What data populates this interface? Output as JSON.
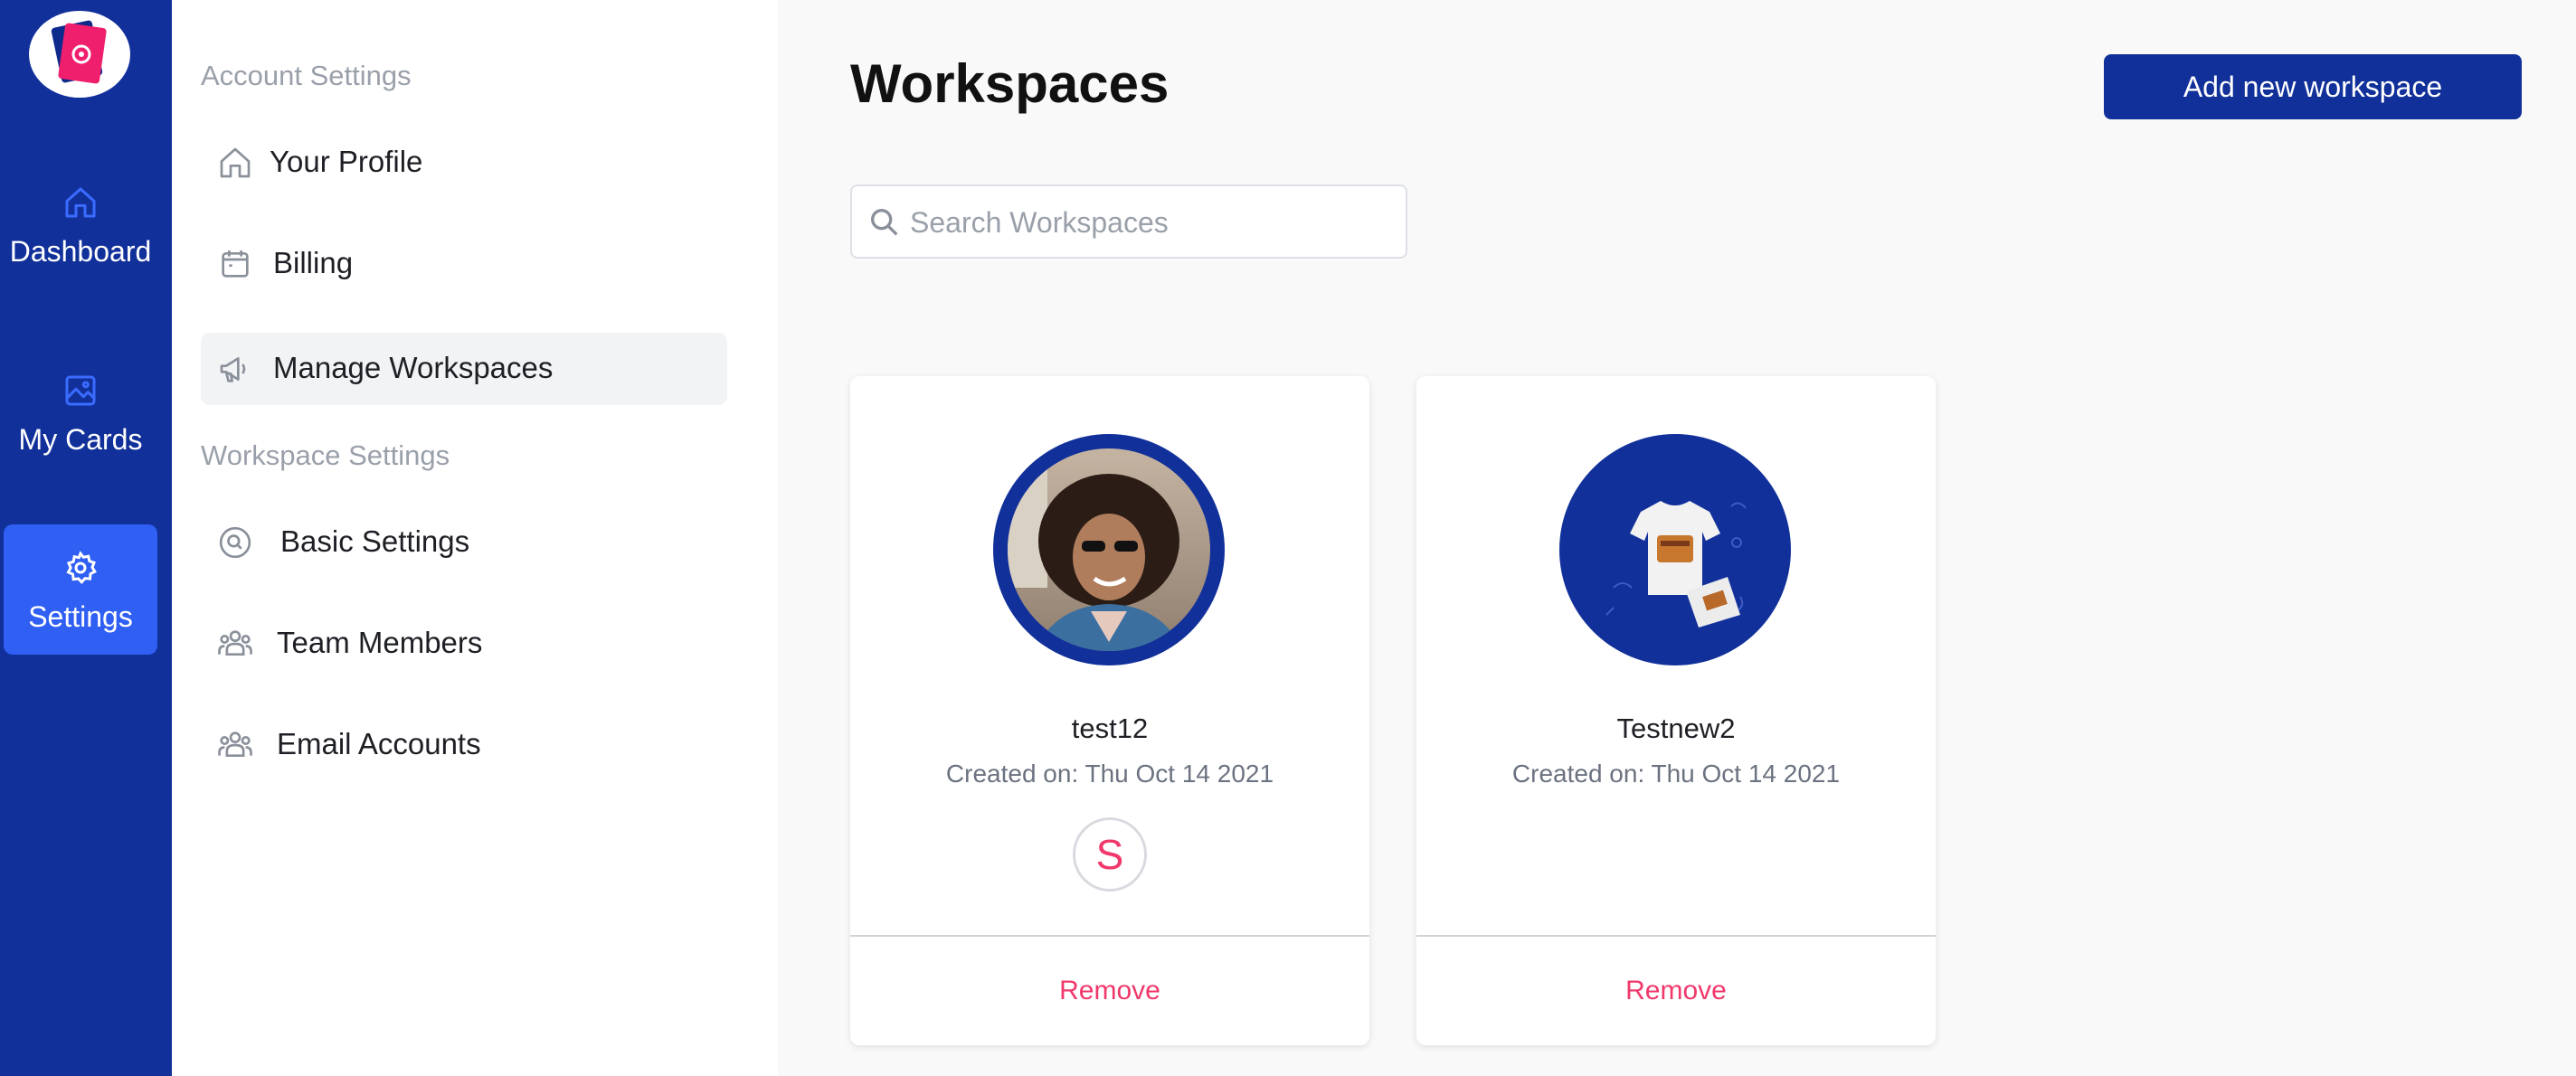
{
  "rail": {
    "items": [
      {
        "label": "Dashboard",
        "icon": "home-icon",
        "active": false
      },
      {
        "label": "My Cards",
        "icon": "image-icon",
        "active": false
      },
      {
        "label": "Settings",
        "icon": "gear-icon",
        "active": true
      }
    ]
  },
  "menu": {
    "account_heading": "Account Settings",
    "account_items": [
      {
        "label": "Your Profile",
        "icon": "home-icon"
      },
      {
        "label": "Billing",
        "icon": "calendar-icon"
      },
      {
        "label": "Manage Workspaces",
        "icon": "megaphone-icon",
        "active": true
      }
    ],
    "workspace_heading": "Workspace Settings",
    "workspace_items": [
      {
        "label": "Basic Settings",
        "icon": "search-circle-icon"
      },
      {
        "label": "Team Members",
        "icon": "users-icon"
      },
      {
        "label": "Email Accounts",
        "icon": "users-icon"
      }
    ]
  },
  "main": {
    "title": "Workspaces",
    "add_button": "Add new workspace",
    "search_placeholder": "Search Workspaces",
    "workspaces": [
      {
        "name": "test12",
        "created": "Created on: Thu Oct 14 2021",
        "member_initial": "S",
        "remove_label": "Remove"
      },
      {
        "name": "Testnew2",
        "created": "Created on: Thu Oct 14 2021",
        "remove_label": "Remove"
      }
    ]
  },
  "colors": {
    "brand": "#11309a",
    "accent": "#2f5ff3",
    "danger": "#f0386b"
  }
}
